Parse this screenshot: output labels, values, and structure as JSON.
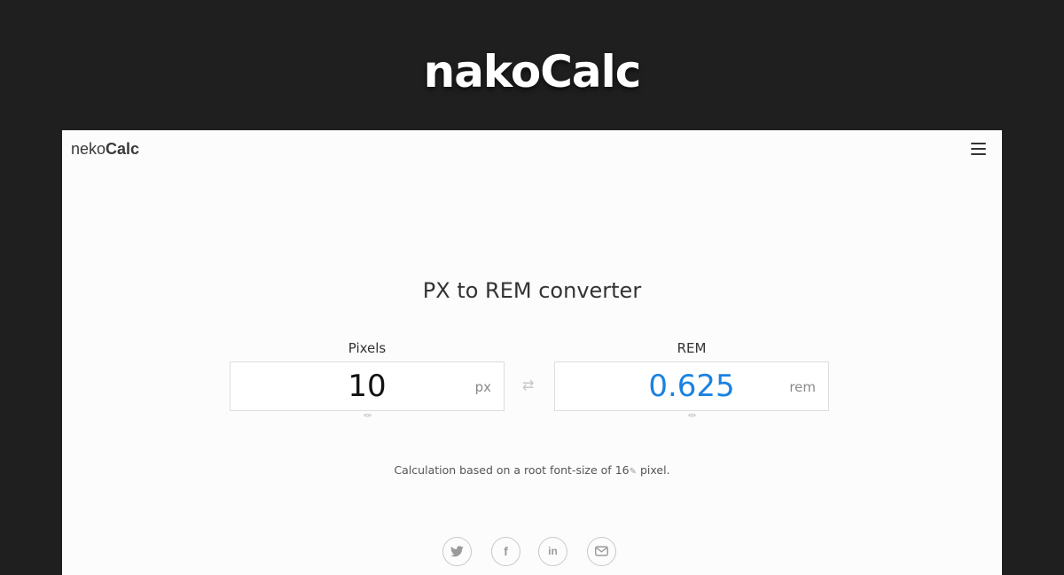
{
  "banner": {
    "title": "nakoCalc"
  },
  "navbar": {
    "logo_light": "neko",
    "logo_bold": "Calc"
  },
  "converter": {
    "title": "PX to REM converter",
    "pixels": {
      "label": "Pixels",
      "value": "10",
      "unit": "px"
    },
    "rem": {
      "label": "REM",
      "value": "0.625",
      "unit": "rem"
    },
    "resize_glyph": "«»",
    "swap_glyph": "⇄"
  },
  "note": {
    "prefix": "Calculation based on a root font-size of",
    "root_size": "16",
    "suffix": "pixel."
  },
  "social": {
    "twitter": "twitter-icon",
    "facebook": "facebook-icon",
    "facebook_glyph": "f",
    "linkedin": "linkedin-icon",
    "linkedin_glyph": "in",
    "email": "mail-icon"
  },
  "colors": {
    "background": "#1f1f1f",
    "panel": "#fcfcfc",
    "accent": "#1a82e2"
  }
}
